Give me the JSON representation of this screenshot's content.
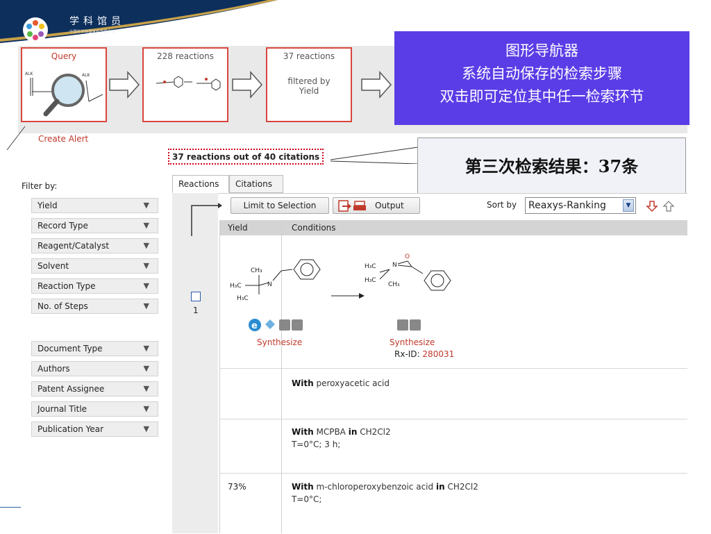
{
  "logo": {
    "title": "学科馆员",
    "subtitle": "中国科学院国家科学图书馆"
  },
  "steps": [
    {
      "label": "Query"
    },
    {
      "label": "228 reactions"
    },
    {
      "label": "37 reactions",
      "sub": "filtered by Yield"
    }
  ],
  "create_alert": "Create Alert",
  "callouts": {
    "navigator": [
      "图形导航器",
      "系统自动保存的检索步骤",
      "双击即可定位其中任一检索环节"
    ],
    "result": "第三次检索结果：37条"
  },
  "results_count": "37 reactions out of 40 citations",
  "filter": {
    "label": "Filter by:",
    "group1": [
      "Yield",
      "Record Type",
      "Reagent/Catalyst",
      "Solvent",
      "Reaction Type",
      "No. of Steps"
    ],
    "group2": [
      "Document Type",
      "Authors",
      "Patent Assignee",
      "Journal Title",
      "Publication Year"
    ]
  },
  "tabs": [
    "Reactions",
    "Citations"
  ],
  "toolbar": {
    "limit": "Limit to Selection",
    "output": "Output",
    "sort_label": "Sort by",
    "sort_value": "Reaxys-Ranking"
  },
  "table": {
    "col_yield": "Yield",
    "col_conditions": "Conditions"
  },
  "reaction": {
    "number": "1",
    "synthesize_left": "Synthesize",
    "synthesize_right": "Synthesize",
    "rx_label": "Rx-ID:",
    "rx_id": "280031"
  },
  "conditions": [
    {
      "yield": "",
      "with": "With",
      "reagent": "peroxyacetic acid",
      "in": "",
      "solvent": "",
      "extra": ""
    },
    {
      "yield": "",
      "with": "With",
      "reagent": "MCPBA",
      "in": "in",
      "solvent": "CH2Cl2",
      "extra": "T=0°C; 3 h;"
    },
    {
      "yield": "73%",
      "with": "With",
      "reagent": "m-chloroperoxybenzoic acid",
      "in": "in",
      "solvent": "CH2Cl2",
      "extra": "T=0°C;"
    }
  ],
  "colors": {
    "accent_red": "#d9453c",
    "callout_purple": "#5a3de6",
    "banner_navy": "#0c2f5c",
    "banner_gold": "#c8a24a"
  }
}
